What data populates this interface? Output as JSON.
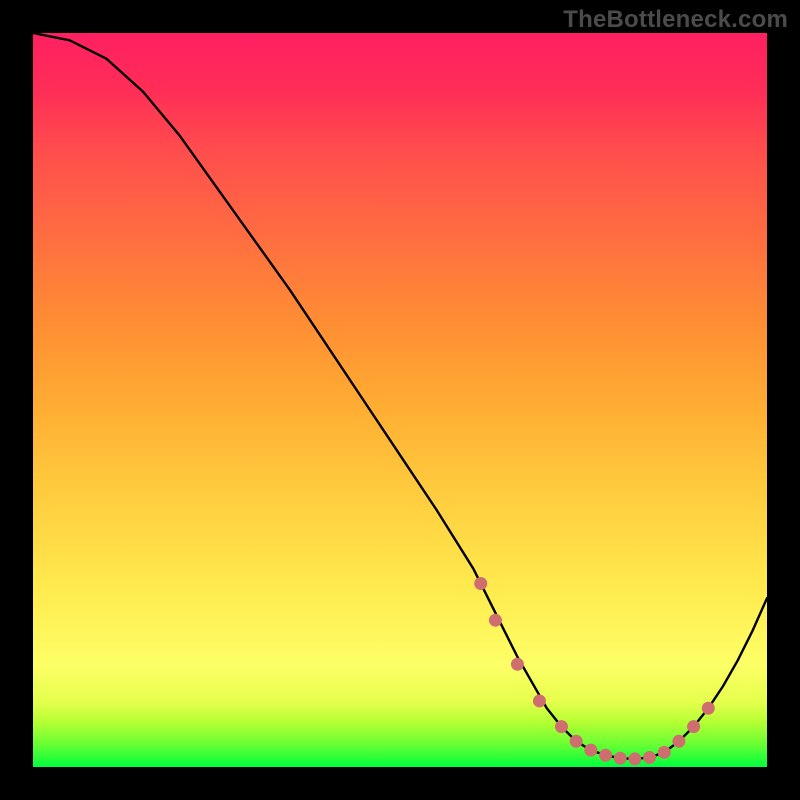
{
  "watermark": "TheBottleneck.com",
  "chart_data": {
    "type": "line",
    "title": "",
    "xlabel": "",
    "ylabel": "",
    "xlim": [
      0,
      100
    ],
    "ylim": [
      0,
      100
    ],
    "x": [
      0,
      5,
      10,
      15,
      20,
      25,
      30,
      35,
      40,
      45,
      50,
      55,
      60,
      62,
      64,
      66,
      68,
      70,
      72,
      74,
      76,
      78,
      80,
      82,
      84,
      86,
      88,
      90,
      92,
      94,
      96,
      98,
      100
    ],
    "values": [
      100,
      99,
      96.5,
      92,
      86,
      79,
      72,
      65,
      57.5,
      50,
      42.5,
      35,
      27,
      23,
      19,
      15,
      11.5,
      8,
      5.5,
      3.5,
      2.3,
      1.6,
      1.2,
      1.1,
      1.3,
      2,
      3.5,
      5.5,
      8,
      11,
      14.5,
      18.5,
      23
    ],
    "markers": {
      "x": [
        61,
        63,
        66,
        69,
        72,
        74,
        76,
        78,
        80,
        82,
        84,
        86,
        88,
        90,
        92
      ],
      "values": [
        25,
        20,
        14,
        9,
        5.5,
        3.5,
        2.3,
        1.6,
        1.2,
        1.1,
        1.3,
        2,
        3.5,
        5.5,
        8
      ]
    },
    "note": "Axes are unlabeled; x/y expressed as percent of plot width/height. Curve is a bottleneck profile: steep monotone decrease with convex onset, flat minimum near x≈80–84 (~1% height), then rising tail to ~23% at right edge. Filled circular markers cluster along the descent into and around the minimum."
  }
}
